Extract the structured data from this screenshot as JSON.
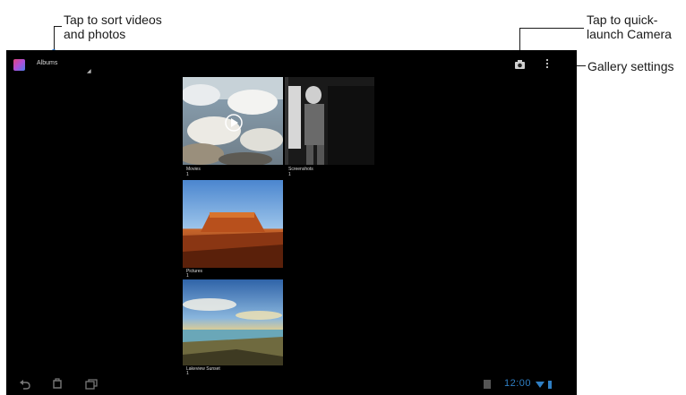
{
  "annotations": {
    "sort": [
      "Tap to sort videos",
      "and photos"
    ],
    "camera": [
      "Tap to quick-",
      "launch Camera"
    ],
    "settings": "Gallery settings"
  },
  "topbar": {
    "title": "Albums",
    "app_icon": "gallery-app-icon",
    "camera_icon": "camera-icon",
    "menu_icon": "overflow-menu-icon"
  },
  "albums": [
    {
      "name": "Movies",
      "count": "1"
    },
    {
      "name": "Screenshots",
      "count": "1"
    },
    {
      "name": "Pictures",
      "count": "1"
    },
    {
      "name": "Lakeview Sunset",
      "count": "1"
    }
  ],
  "status": {
    "time": "12:00"
  },
  "colors": {
    "accent": "#1a73d9",
    "status_blue": "#2f7fc4",
    "screen_bg": "#000000"
  }
}
